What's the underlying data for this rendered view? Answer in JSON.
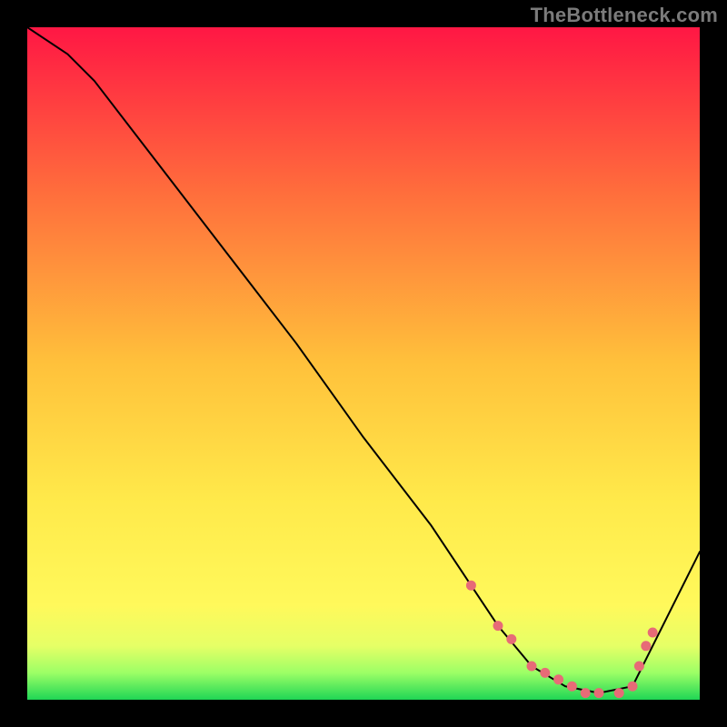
{
  "watermark": "TheBottleneck.com",
  "colors": {
    "gradient_stops": [
      {
        "offset": "0%",
        "color": "#ff1744"
      },
      {
        "offset": "25%",
        "color": "#ff6f3c"
      },
      {
        "offset": "50%",
        "color": "#ffc13b"
      },
      {
        "offset": "70%",
        "color": "#ffe94a"
      },
      {
        "offset": "86%",
        "color": "#fff95b"
      },
      {
        "offset": "92%",
        "color": "#e6ff66"
      },
      {
        "offset": "96%",
        "color": "#9cff66"
      },
      {
        "offset": "100%",
        "color": "#1fd655"
      }
    ],
    "curve": "#000000",
    "marker_fill": "#e76b77",
    "marker_stroke": "#e76b77"
  },
  "chart_data": {
    "type": "line",
    "title": "",
    "xlabel": "",
    "ylabel": "",
    "xlim": [
      0,
      100
    ],
    "ylim": [
      0,
      100
    ],
    "series": [
      {
        "name": "bottleneck-curve",
        "x": [
          0,
          6,
          10,
          20,
          30,
          40,
          50,
          60,
          66,
          70,
          75,
          80,
          85,
          90,
          95,
          100
        ],
        "y": [
          100,
          96,
          92,
          79,
          66,
          53,
          39,
          26,
          17,
          11,
          5,
          2,
          1,
          2,
          12,
          22
        ]
      }
    ],
    "markers": {
      "name": "highlight-dots",
      "x": [
        66,
        70,
        72,
        75,
        77,
        79,
        81,
        83,
        85,
        88,
        90,
        91,
        92,
        93
      ],
      "y": [
        17,
        11,
        9,
        5,
        4,
        3,
        2,
        1,
        1,
        1,
        2,
        5,
        8,
        10
      ],
      "r": 5
    }
  }
}
